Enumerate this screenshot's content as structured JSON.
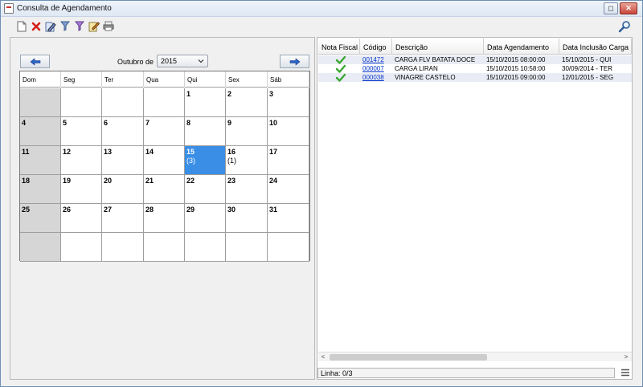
{
  "window": {
    "title": "Consulta de Agendamento",
    "restore_label": "◻",
    "close_label": "✕"
  },
  "toolbar": {
    "buttons": [
      {
        "icon": "new-document-icon"
      },
      {
        "icon": "delete-icon"
      },
      {
        "icon": "edit-document-icon"
      },
      {
        "icon": "filter-icon"
      },
      {
        "icon": "filter-active-icon"
      },
      {
        "icon": "edit-icon"
      },
      {
        "icon": "print-icon"
      }
    ],
    "search_icon": "search-icon"
  },
  "calendar": {
    "month_label": "Outubro de",
    "year": "2015",
    "weekdays": [
      "Dom",
      "Seg",
      "Ter",
      "Qua",
      "Qui",
      "Sex",
      "Sáb"
    ],
    "weeks": [
      [
        {
          "d": ""
        },
        {
          "d": ""
        },
        {
          "d": ""
        },
        {
          "d": ""
        },
        {
          "d": "1"
        },
        {
          "d": "2"
        },
        {
          "d": "3"
        }
      ],
      [
        {
          "d": "4"
        },
        {
          "d": "5"
        },
        {
          "d": "6"
        },
        {
          "d": "7"
        },
        {
          "d": "8"
        },
        {
          "d": "9"
        },
        {
          "d": "10"
        }
      ],
      [
        {
          "d": "11"
        },
        {
          "d": "12"
        },
        {
          "d": "13"
        },
        {
          "d": "14"
        },
        {
          "d": "15",
          "count": "(3)",
          "selected": true
        },
        {
          "d": "16",
          "count": "(1)"
        },
        {
          "d": "17"
        }
      ],
      [
        {
          "d": "18"
        },
        {
          "d": "19"
        },
        {
          "d": "20"
        },
        {
          "d": "21"
        },
        {
          "d": "22"
        },
        {
          "d": "23"
        },
        {
          "d": "24"
        }
      ],
      [
        {
          "d": "25"
        },
        {
          "d": "26"
        },
        {
          "d": "27"
        },
        {
          "d": "28"
        },
        {
          "d": "29"
        },
        {
          "d": "30"
        },
        {
          "d": "31"
        }
      ],
      [
        {
          "d": ""
        },
        {
          "d": ""
        },
        {
          "d": ""
        },
        {
          "d": ""
        },
        {
          "d": ""
        },
        {
          "d": ""
        },
        {
          "d": ""
        }
      ]
    ],
    "selected_color": "#3a8ee6"
  },
  "table": {
    "columns": [
      "Nota Fiscal",
      "Código",
      "Descrição",
      "Data Agendamento",
      "Data Inclusão Carga"
    ],
    "rows": [
      {
        "nota_fiscal": "check-icon",
        "codigo": "001472",
        "descricao": "CARGA FLV BATATA DOCE",
        "data_agendamento": "15/10/2015 08:00:00",
        "data_inclusao": "15/10/2015 - QUI"
      },
      {
        "nota_fiscal": "check-icon",
        "codigo": "000007",
        "descricao": "CARGA LIRAN",
        "data_agendamento": "15/10/2015 10:58:00",
        "data_inclusao": "30/09/2014 - TER"
      },
      {
        "nota_fiscal": "check-icon",
        "codigo": "000038",
        "descricao": "VINAGRE CASTELO",
        "data_agendamento": "15/10/2015 09:00:00",
        "data_inclusao": "12/01/2015 - SEG"
      }
    ],
    "scroll_left": "<",
    "scroll_right": ">"
  },
  "status": {
    "text": "Linha: 0/3"
  },
  "colors": {
    "link": "#0033cc",
    "check": "#3aa832",
    "row_alt": "#e9ecf4"
  }
}
